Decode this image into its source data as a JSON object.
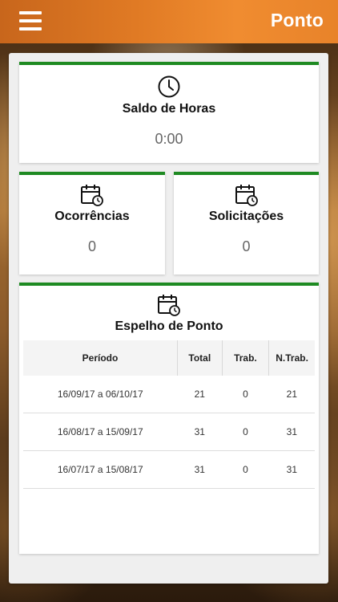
{
  "header": {
    "title": "Ponto",
    "menu_icon": "hamburger-menu-icon"
  },
  "colors": {
    "header_orange": "#e07a24",
    "card_accent_green": "#1e8a22",
    "value_gray": "#666666"
  },
  "saldo": {
    "icon": "clock-icon",
    "title": "Saldo de Horas",
    "value": "0:00"
  },
  "ocorrencias": {
    "icon": "calendar-clock-icon",
    "title": "Ocorrências",
    "value": "0"
  },
  "solicitacoes": {
    "icon": "calendar-clock-icon",
    "title": "Solicitações",
    "value": "0"
  },
  "espelho": {
    "icon": "calendar-clock-icon",
    "title": "Espelho de Ponto",
    "columns": [
      "Período",
      "Total",
      "Trab.",
      "N.Trab."
    ],
    "rows": [
      {
        "periodo": "16/09/17 a 06/10/17",
        "total": "21",
        "trab": "0",
        "ntrab": "21"
      },
      {
        "periodo": "16/08/17 a 15/09/17",
        "total": "31",
        "trab": "0",
        "ntrab": "31"
      },
      {
        "periodo": "16/07/17 a 15/08/17",
        "total": "31",
        "trab": "0",
        "ntrab": "31"
      }
    ]
  }
}
